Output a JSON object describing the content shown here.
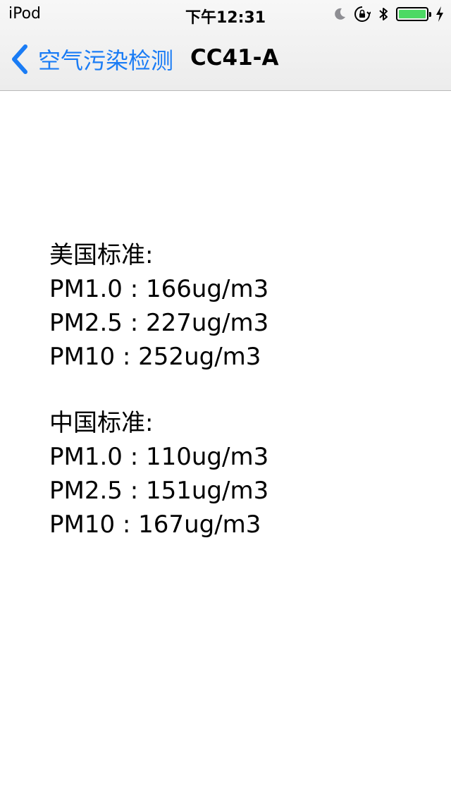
{
  "status_bar": {
    "carrier": "iPod",
    "time": "下午12:31",
    "battery_level": 1.0,
    "icons": [
      "moon-icon",
      "orientation-lock-icon",
      "bluetooth-icon",
      "battery-icon",
      "charging-bolt-icon"
    ]
  },
  "nav": {
    "back_label": "空气污染检测",
    "title": "CC41-A"
  },
  "colors": {
    "accent": "#1a7cf5",
    "battery": "#4cd964"
  },
  "readings": {
    "us": {
      "heading": "美国标准:",
      "lines": [
        "PM1.0 : 166ug/m3",
        "PM2.5 : 227ug/m3",
        "PM10 : 252ug/m3"
      ]
    },
    "cn": {
      "heading": "中国标准:",
      "lines": [
        "PM1.0 : 110ug/m3",
        "PM2.5 : 151ug/m3",
        "PM10 : 167ug/m3"
      ]
    }
  }
}
